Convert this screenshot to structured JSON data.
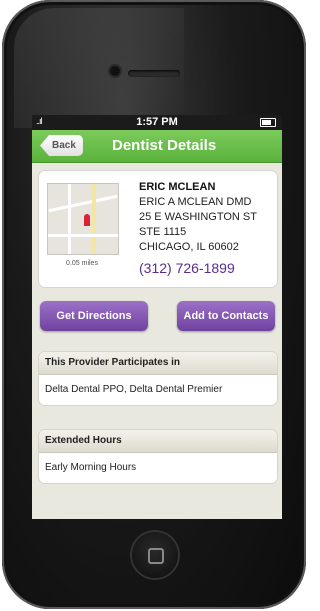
{
  "status_bar": {
    "signal": "..ıl",
    "time": "1:57 PM"
  },
  "nav": {
    "back_label": "Back",
    "title": "Dentist Details"
  },
  "provider": {
    "name": "ERIC MCLEAN",
    "address_lines": [
      "ERIC A MCLEAN DMD",
      "25 E WASHINGTON ST",
      "STE 1115",
      "CHICAGO, IL 60602"
    ],
    "phone": "(312) 726-1899",
    "distance": "0.05 miles"
  },
  "actions": {
    "directions_label": "Get Directions",
    "contacts_label": "Add to Contacts"
  },
  "sections": [
    {
      "title": "This Provider Participates in",
      "value": "Delta Dental PPO, Delta Dental Premier"
    },
    {
      "title": "Extended Hours",
      "value": "Early Morning Hours"
    }
  ],
  "colors": {
    "nav_green": "#5bb23c",
    "button_purple": "#6f42a0",
    "phone_purple": "#5b2c8f"
  }
}
